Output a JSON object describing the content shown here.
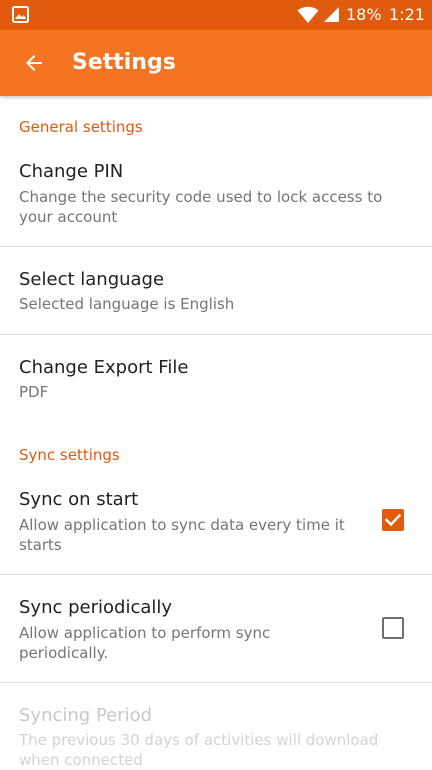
{
  "status_bar": {
    "battery": "18%",
    "time": "1:21",
    "icons": [
      "gallery-icon",
      "wifi-icon",
      "signal-icon",
      "battery-icon"
    ]
  },
  "app_bar": {
    "title": "Settings",
    "back_icon": "arrow-left-icon"
  },
  "colors": {
    "status_bar": "#e15b0e",
    "app_bar": "#f57421",
    "accent": "#e15b0e"
  },
  "general": {
    "header": "General settings",
    "change_pin": {
      "title": "Change PIN",
      "summary": "Change the security code used to lock access to your account"
    },
    "select_language": {
      "title": "Select language",
      "summary": "Selected language is English"
    },
    "change_export": {
      "title": "Change Export File",
      "summary": "PDF"
    }
  },
  "sync": {
    "header": "Sync settings",
    "sync_on_start": {
      "title": "Sync on start",
      "summary": "Allow application to sync data every time it starts",
      "checked": true
    },
    "sync_periodically": {
      "title": "Sync periodically",
      "summary": "Allow application to perform sync periodically.",
      "checked": false
    },
    "syncing_period": {
      "title": "Syncing Period",
      "summary": "The previous 30 days of activities will download when connected",
      "enabled": false
    }
  }
}
